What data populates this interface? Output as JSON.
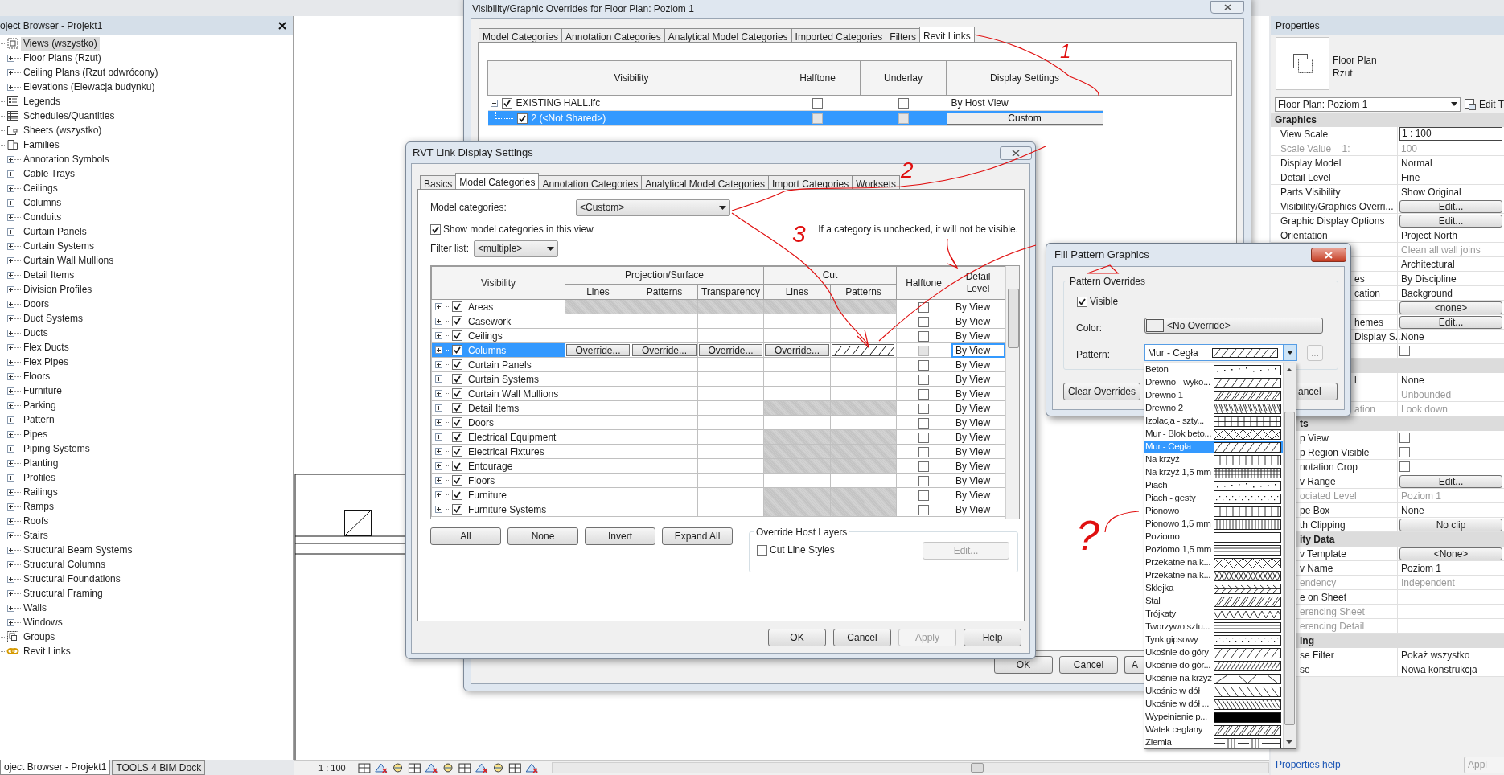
{
  "project_browser": {
    "title": "oject Browser - Projekt1",
    "tree": [
      {
        "label": "Views (wszystko)",
        "kind": "views",
        "selected": true,
        "children": [
          {
            "label": "Floor Plans (Rzut)",
            "expanded": false
          },
          {
            "label": "Ceiling Plans (Rzut odwrócony)",
            "expanded": false
          },
          {
            "label": "Elevations (Elewacja budynku)",
            "expanded": false
          }
        ]
      },
      {
        "label": "Legends",
        "kind": "legends",
        "selected": false
      },
      {
        "label": "Schedules/Quantities",
        "kind": "schedules",
        "selected": false
      },
      {
        "label": "Sheets (wszystko)",
        "kind": "sheets",
        "selected": false
      },
      {
        "label": "Families",
        "kind": "families",
        "selected": false,
        "children": [
          {
            "label": "Annotation Symbols",
            "expanded": false
          },
          {
            "label": "Cable Trays",
            "expanded": false
          },
          {
            "label": "Ceilings",
            "expanded": false
          },
          {
            "label": "Columns",
            "expanded": false
          },
          {
            "label": "Conduits",
            "expanded": false
          },
          {
            "label": "Curtain Panels",
            "expanded": false
          },
          {
            "label": "Curtain Systems",
            "expanded": false
          },
          {
            "label": "Curtain Wall Mullions",
            "expanded": false
          },
          {
            "label": "Detail Items",
            "expanded": false
          },
          {
            "label": "Division Profiles",
            "expanded": false
          },
          {
            "label": "Doors",
            "expanded": false
          },
          {
            "label": "Duct Systems",
            "expanded": false
          },
          {
            "label": "Ducts",
            "expanded": false
          },
          {
            "label": "Flex Ducts",
            "expanded": false
          },
          {
            "label": "Flex Pipes",
            "expanded": false
          },
          {
            "label": "Floors",
            "expanded": false
          },
          {
            "label": "Furniture",
            "expanded": false
          },
          {
            "label": "Parking",
            "expanded": false
          },
          {
            "label": "Pattern",
            "expanded": false
          },
          {
            "label": "Pipes",
            "expanded": false
          },
          {
            "label": "Piping Systems",
            "expanded": false
          },
          {
            "label": "Planting",
            "expanded": false
          },
          {
            "label": "Profiles",
            "expanded": false
          },
          {
            "label": "Railings",
            "expanded": false
          },
          {
            "label": "Ramps",
            "expanded": false
          },
          {
            "label": "Roofs",
            "expanded": false
          },
          {
            "label": "Stairs",
            "expanded": false
          },
          {
            "label": "Structural Beam Systems",
            "expanded": false
          },
          {
            "label": "Structural Columns",
            "expanded": false
          },
          {
            "label": "Structural Foundations",
            "expanded": false
          },
          {
            "label": "Structural Framing",
            "expanded": false
          },
          {
            "label": "Walls",
            "expanded": false
          },
          {
            "label": "Windows",
            "expanded": false
          }
        ]
      },
      {
        "label": "Groups",
        "kind": "groups",
        "selected": false
      },
      {
        "label": "Revit Links",
        "kind": "links",
        "selected": false
      }
    ]
  },
  "bottom_tabs": [
    {
      "label": "oject Browser - Projekt1",
      "selected": true
    },
    {
      "label": "TOOLS 4 BIM Dock",
      "selected": false
    }
  ],
  "status_bar": {
    "scale": "1 : 100"
  },
  "vg_dialog": {
    "title": "Visibility/Graphic Overrides for Floor Plan: Poziom 1",
    "tabs": [
      {
        "label": "Model Categories",
        "selected": false
      },
      {
        "label": "Annotation Categories",
        "selected": false
      },
      {
        "label": "Analytical Model Categories",
        "selected": false
      },
      {
        "label": "Imported Categories",
        "selected": false
      },
      {
        "label": "Filters",
        "selected": false
      },
      {
        "label": "Revit Links",
        "selected": true
      }
    ],
    "columns": [
      "Visibility",
      "Halftone",
      "Underlay",
      "Display Settings"
    ],
    "rows": [
      {
        "name": "EXISTING HALL.ifc",
        "expanded": true,
        "checked": true,
        "halftone": false,
        "underlay": false,
        "display": "By Host View",
        "selected": false,
        "children": [
          {
            "name": "2 (<Not Shared>)",
            "checked": true,
            "halftone": false,
            "underlay": false,
            "display": "Custom",
            "selected": true
          }
        ]
      }
    ],
    "buttons": [
      "OK",
      "Cancel",
      "A"
    ]
  },
  "rvt_dialog": {
    "title": "RVT Link Display Settings",
    "tabs": [
      {
        "label": "Basics",
        "selected": false
      },
      {
        "label": "Model Categories",
        "selected": true
      },
      {
        "label": "Annotation Categories",
        "selected": false
      },
      {
        "label": "Analytical Model Categories",
        "selected": false
      },
      {
        "label": "Import Categories",
        "selected": false
      },
      {
        "label": "Worksets",
        "selected": false
      }
    ],
    "model_categories": {
      "label": "Model categories:",
      "value": "<Custom>"
    },
    "show_in_view": {
      "label": "Show model categories in this view",
      "checked": true
    },
    "filter": {
      "label": "Filter list:",
      "value": "<multiple>"
    },
    "note": "If a category is unchecked, it will not be visible.",
    "headers": {
      "visibility": "Visibility",
      "projection": "Projection/Surface",
      "cut": "Cut",
      "halftone": "Halftone",
      "detail": "Detail Level",
      "sub": [
        "Lines",
        "Patterns",
        "Transparency",
        "Lines",
        "Patterns"
      ]
    },
    "rows": [
      {
        "name": "Areas",
        "checked": true,
        "halftone": false,
        "detail": "By View",
        "selected": false,
        "projection_shaded": true,
        "cut_shaded": true
      },
      {
        "name": "Casework",
        "checked": true,
        "halftone": false,
        "detail": "By View",
        "selected": false,
        "projection_shaded": false,
        "cut_shaded": false
      },
      {
        "name": "Ceilings",
        "checked": true,
        "halftone": false,
        "detail": "By View",
        "selected": false,
        "projection_shaded": false,
        "cut_shaded": false
      },
      {
        "name": "Columns",
        "checked": true,
        "halftone": false,
        "detail": "By View",
        "selected": true,
        "projection_shaded": false,
        "cut_shaded": false,
        "overrides": [
          "Override...",
          "Override...",
          "Override...",
          "Override..."
        ]
      },
      {
        "name": "Curtain Panels",
        "checked": true,
        "halftone": false,
        "detail": "By View",
        "selected": false,
        "projection_shaded": false,
        "cut_shaded": false
      },
      {
        "name": "Curtain Systems",
        "checked": true,
        "halftone": false,
        "detail": "By View",
        "selected": false,
        "projection_shaded": false,
        "cut_shaded": false
      },
      {
        "name": "Curtain Wall Mullions",
        "checked": true,
        "halftone": false,
        "detail": "By View",
        "selected": false,
        "projection_shaded": false,
        "cut_shaded": false
      },
      {
        "name": "Detail Items",
        "checked": true,
        "halftone": false,
        "detail": "By View",
        "selected": false,
        "projection_shaded": false,
        "cut_shaded": true
      },
      {
        "name": "Doors",
        "checked": true,
        "halftone": false,
        "detail": "By View",
        "selected": false,
        "projection_shaded": false,
        "cut_shaded": false
      },
      {
        "name": "Electrical Equipment",
        "checked": true,
        "halftone": false,
        "detail": "By View",
        "selected": false,
        "projection_shaded": false,
        "cut_shaded": true
      },
      {
        "name": "Electrical Fixtures",
        "checked": true,
        "halftone": false,
        "detail": "By View",
        "selected": false,
        "projection_shaded": false,
        "cut_shaded": true
      },
      {
        "name": "Entourage",
        "checked": true,
        "halftone": false,
        "detail": "By View",
        "selected": false,
        "projection_shaded": false,
        "cut_shaded": true
      },
      {
        "name": "Floors",
        "checked": true,
        "halftone": false,
        "detail": "By View",
        "selected": false,
        "projection_shaded": false,
        "cut_shaded": false
      },
      {
        "name": "Furniture",
        "checked": true,
        "halftone": false,
        "detail": "By View",
        "selected": false,
        "projection_shaded": false,
        "cut_shaded": true
      },
      {
        "name": "Furniture Systems",
        "checked": true,
        "halftone": false,
        "detail": "By View",
        "selected": false,
        "projection_shaded": false,
        "cut_shaded": true
      }
    ],
    "buttons": [
      "All",
      "None",
      "Invert",
      "Expand All"
    ],
    "host_layers": {
      "title": "Override Host Layers",
      "checkbox": {
        "label": "Cut Line Styles",
        "checked": false
      },
      "edit": {
        "label": "Edit...",
        "disabled": true
      }
    },
    "footer": [
      {
        "label": "OK",
        "disabled": false
      },
      {
        "label": "Cancel",
        "disabled": false
      },
      {
        "label": "Apply",
        "disabled": true
      },
      {
        "label": "Help",
        "disabled": false
      }
    ]
  },
  "fill_dialog": {
    "title": "Fill Pattern Graphics",
    "group": "Pattern Overrides",
    "visible": {
      "label": "Visible",
      "checked": true
    },
    "color": {
      "label": "Color:",
      "value": "<No Override>"
    },
    "pattern": {
      "label": "Pattern:",
      "value": "Mur - Cegła",
      "browse": "..."
    },
    "clear": "Clear Overrides",
    "cancel": "ancel",
    "options": [
      {
        "label": "Beton",
        "selected": false
      },
      {
        "label": "Drewno - wyko...",
        "selected": false
      },
      {
        "label": "Drewno 1",
        "selected": false
      },
      {
        "label": "Drewno 2",
        "selected": false
      },
      {
        "label": "Izolacja - szty...",
        "selected": false
      },
      {
        "label": "Mur - Blok beto...",
        "selected": false
      },
      {
        "label": "Mur - Cegła",
        "selected": true
      },
      {
        "label": "Na krzyż",
        "selected": false
      },
      {
        "label": "Na krzyż 1,5 mm",
        "selected": false
      },
      {
        "label": "Piach",
        "selected": false
      },
      {
        "label": "Piach - gesty",
        "selected": false
      },
      {
        "label": "Pionowo",
        "selected": false
      },
      {
        "label": "Pionowo 1,5 mm",
        "selected": false
      },
      {
        "label": "Poziomo",
        "selected": false
      },
      {
        "label": "Poziomo 1,5 mm",
        "selected": false
      },
      {
        "label": "Przekatne na k...",
        "selected": false
      },
      {
        "label": "Przekatne na k...",
        "selected": false
      },
      {
        "label": "Sklejka",
        "selected": false
      },
      {
        "label": "Stal",
        "selected": false
      },
      {
        "label": "Trójkaty",
        "selected": false
      },
      {
        "label": "Tworzywo sztu...",
        "selected": false
      },
      {
        "label": "Tynk gipsowy",
        "selected": false
      },
      {
        "label": "Ukośnie do góry",
        "selected": false
      },
      {
        "label": "Ukośnie do gór...",
        "selected": false
      },
      {
        "label": "Ukośnie na krzyż",
        "selected": false
      },
      {
        "label": "Ukośnie w dół",
        "selected": false
      },
      {
        "label": "Ukośnie w dół ...",
        "selected": false
      },
      {
        "label": "Wypełnienie p...",
        "selected": false
      },
      {
        "label": "Watek ceglany",
        "selected": false
      },
      {
        "label": "Ziemia",
        "selected": false
      }
    ]
  },
  "properties": {
    "title": "Properties",
    "type_name": "Floor Plan",
    "type_sub": "Rzut",
    "instance": "Floor Plan: Poziom 1",
    "edit_type": "Edit T",
    "rows": [
      {
        "kind": "header",
        "label": "Graphics"
      },
      {
        "kind": "input",
        "label": "View Scale",
        "value": "1 : 100"
      },
      {
        "kind": "text",
        "label": "Scale Value    1:",
        "value": "100",
        "disabled": true
      },
      {
        "kind": "text",
        "label": "Display Model",
        "value": "Normal"
      },
      {
        "kind": "text",
        "label": "Detail Level",
        "value": "Fine"
      },
      {
        "kind": "text",
        "label": "Parts Visibility",
        "value": "Show Original"
      },
      {
        "kind": "button",
        "label": "Visibility/Graphics Overri...",
        "value": "Edit..."
      },
      {
        "kind": "button",
        "label": "Graphic Display Options",
        "value": "Edit..."
      },
      {
        "kind": "text",
        "label": "Orientation",
        "value": "Project North"
      },
      {
        "kind": "text",
        "value": "Clean all wall joins",
        "disabled": true
      },
      {
        "kind": "text",
        "value": "Architectural"
      },
      {
        "kind": "text",
        "label": "es",
        "value": "By Discipline"
      },
      {
        "kind": "text",
        "label": "cation",
        "value": "Background"
      },
      {
        "kind": "button",
        "value": "<none>"
      },
      {
        "kind": "button",
        "label": "hemes",
        "value": "Edit..."
      },
      {
        "kind": "text",
        "label": "Display S...",
        "value": "None"
      },
      {
        "kind": "check",
        "checked": false
      },
      {
        "kind": "header"
      },
      {
        "kind": "text",
        "label": "l",
        "value": "None"
      },
      {
        "kind": "text",
        "value": "Unbounded",
        "disabled": true
      },
      {
        "kind": "text",
        "label": "ation",
        "value": "Look down",
        "disabled": true
      },
      {
        "kind": "header",
        "label": "ts"
      },
      {
        "kind": "check",
        "label": "p View",
        "checked": false
      },
      {
        "kind": "check",
        "label": "p Region Visible",
        "checked": false
      },
      {
        "kind": "check",
        "label": "notation Crop",
        "checked": false
      },
      {
        "kind": "button",
        "label": "v Range",
        "value": "Edit..."
      },
      {
        "kind": "text",
        "label": "ociated Level",
        "value": "Poziom 1",
        "disabled": true
      },
      {
        "kind": "text",
        "label": "pe Box",
        "value": "None"
      },
      {
        "kind": "button",
        "label": "th Clipping",
        "value": "No clip"
      },
      {
        "kind": "header",
        "label": "ity Data"
      },
      {
        "kind": "button",
        "label": "v Template",
        "value": "<None>"
      },
      {
        "kind": "text",
        "label": "v Name",
        "value": "Poziom 1"
      },
      {
        "kind": "text",
        "label": "endency",
        "value": "Independent",
        "disabled": true
      },
      {
        "kind": "text",
        "label": "e on Sheet"
      },
      {
        "kind": "text",
        "label": "erencing Sheet",
        "disabled": true
      },
      {
        "kind": "text",
        "label": "erencing Detail",
        "disabled": true
      },
      {
        "kind": "header",
        "label": "ing"
      },
      {
        "kind": "text",
        "label": "se Filter",
        "value": "Pokaż wszystko"
      },
      {
        "kind": "text",
        "label": "se",
        "value": "Nowa konstrukcja"
      }
    ],
    "help": "Properties help",
    "apply": "Appl"
  },
  "annotations": [
    {
      "text": "1"
    },
    {
      "text": "2"
    },
    {
      "text": "3"
    },
    {
      "text": "?"
    }
  ]
}
